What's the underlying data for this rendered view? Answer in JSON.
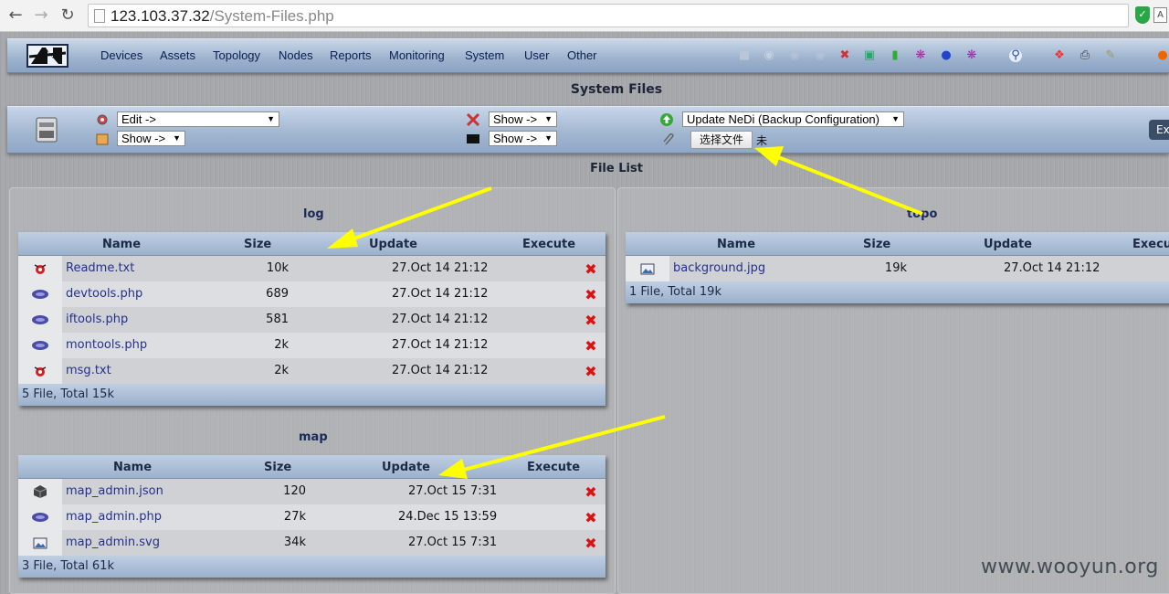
{
  "browser": {
    "url_host": "123.103.37.32",
    "url_path": "/System-Files.php"
  },
  "nav": {
    "menu": [
      "Devices",
      "Assets",
      "Topology",
      "Nodes",
      "Reports",
      "Monitoring",
      "System",
      "User",
      "Other"
    ]
  },
  "page": {
    "title": "System Files",
    "file_list_title": "File List"
  },
  "controls": {
    "edit_select": "Edit ->",
    "show_select_1": "Show ->",
    "show_select_2": "Show ->",
    "show_select_3": "Show ->",
    "update_select": "Update NeDi (Backup Configuration)",
    "file_button": "选择文件",
    "no_file_text": "未",
    "exit_label": "Ex"
  },
  "log": {
    "title": "log",
    "headers": {
      "name": "Name",
      "size": "Size",
      "update": "Update",
      "execute": "Execute"
    },
    "rows": [
      {
        "icon": "bug-icon",
        "name": "Readme.txt",
        "size": "10k",
        "update": "27.Oct 14 21:12"
      },
      {
        "icon": "php-icon",
        "name": "devtools.php",
        "size": "689",
        "update": "27.Oct 14 21:12"
      },
      {
        "icon": "php-icon",
        "name": "iftools.php",
        "size": "581",
        "update": "27.Oct 14 21:12"
      },
      {
        "icon": "php-icon",
        "name": "montools.php",
        "size": "2k",
        "update": "27.Oct 14 21:12"
      },
      {
        "icon": "bug-icon",
        "name": "msg.txt",
        "size": "2k",
        "update": "27.Oct 14 21:12"
      }
    ],
    "footer": "5 File, Total 15k"
  },
  "topo": {
    "title": "topo",
    "headers": {
      "name": "Name",
      "size": "Size",
      "update": "Update",
      "execute": "Execu"
    },
    "rows": [
      {
        "icon": "image-icon",
        "name": "background.jpg",
        "size": "19k",
        "update": "27.Oct 14 21:12"
      }
    ],
    "footer": "1 File, Total 19k"
  },
  "map": {
    "title": "map",
    "headers": {
      "name": "Name",
      "size": "Size",
      "update": "Update",
      "execute": "Execute"
    },
    "rows": [
      {
        "icon": "box-icon",
        "name": "map_admin.json",
        "size": "120",
        "update": "27.Oct 15 7:31"
      },
      {
        "icon": "php-icon",
        "name": "map_admin.php",
        "size": "27k",
        "update": "24.Dec 15 13:59"
      },
      {
        "icon": "image-icon",
        "name": "map_admin.svg",
        "size": "34k",
        "update": "27.Oct 15 7:31"
      }
    ],
    "footer": "3 File, Total 61k"
  },
  "watermark": "www.wooyun.org",
  "colors": {
    "arrow": "#ffff00",
    "delete": "#dd1111",
    "link": "#24318a"
  }
}
